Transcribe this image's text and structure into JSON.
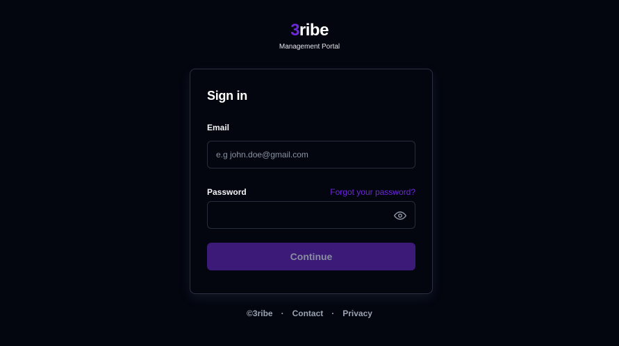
{
  "brand": {
    "logo_accent": "3",
    "logo_rest": "ribe",
    "subtitle": "Management Portal"
  },
  "signin": {
    "title": "Sign in",
    "email_label": "Email",
    "email_placeholder": "e.g john.doe@gmail.com",
    "password_label": "Password",
    "forgot_link": "Forgot your password?",
    "password_value": "",
    "password_toggle_icon": "eye-icon",
    "continue_label": "Continue"
  },
  "footer": {
    "copyright": "©3ribe",
    "separator": "·",
    "contact": "Contact",
    "privacy": "Privacy"
  },
  "colors": {
    "background": "#03060f",
    "accent": "#6d28d9",
    "button_bg": "#3b1a78",
    "border": "#262d3d"
  }
}
